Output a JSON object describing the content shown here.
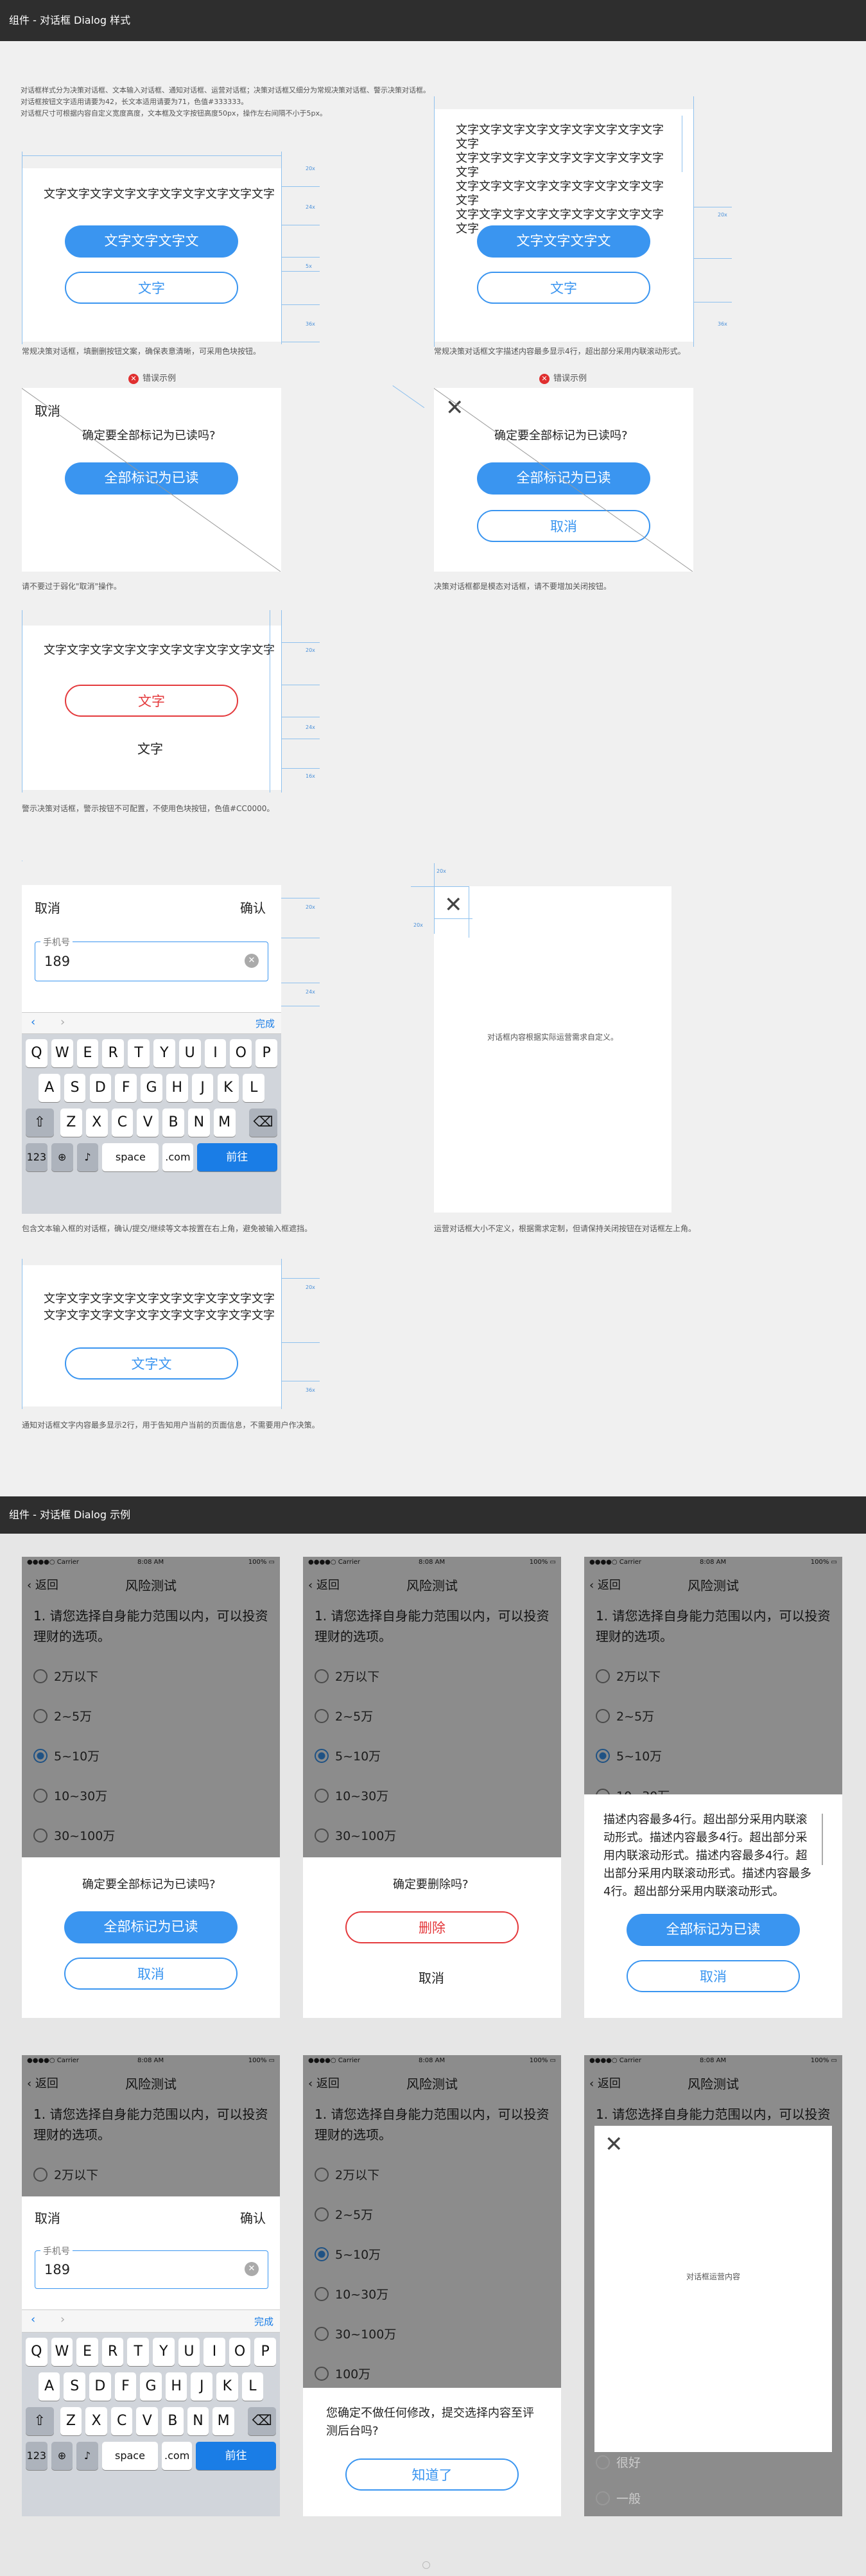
{
  "section1": {
    "title": "组件 - 对话框 Dialog 样式"
  },
  "section2": {
    "title": "组件 - 对话框 Dialog 示例"
  },
  "intro": [
    "对话框样式分为决策对话框、文本输入对话框、通知对话框、运营对话框；决策对话框又细分为常规决策对话框、警示决策对话框。",
    "对话框按钮文字适用请要为42，长文本适用请要为71，色值#333333。",
    "对话框尺寸可根据内容自定义宽度高度，文本框及文字按钮高度50px，操作左右间隔不小于5px。"
  ],
  "sample_text": "文字文字文字文字文字文字文字文字文字文字",
  "btn_text_long": "文字文字文字文",
  "btn_text": "文字",
  "btn_text_2": "文字文",
  "confirm_q": "确定要全部标记为已读吗?",
  "mark_all": "全部标记为已读",
  "cancel": "取消",
  "confirm": "确认",
  "error_label": "错误示例",
  "notes": {
    "n1": "常规决策对话框，填删删按钮文案，确保表意清晰，可采用色块按钮。",
    "n2": "常规决策对话框文字描述内容最多显示4行，超出部分采用内联滚动形式。",
    "n3": "请不要过于弱化\"取消\"操作。",
    "n4": "决策对话框都是模态对话框，请不要增加关闭按钮。",
    "n5": "警示决策对话框，警示按钮不可配置，不使用色块按钮，色值#CC0000。",
    "n6": "包含文本输入框的对话框，确认/提交/继续等文本按置在右上角，避免被输入框遮挡。",
    "n7": "运营对话框大小不定义，根据需求定制，但请保持关闭按钮在对话框左上角。",
    "n8": "通知对话框文字内容最多显示2行，用于告知用户当前的页面信息，不需要用户作决策。"
  },
  "input": {
    "label": "手机号",
    "value": "189"
  },
  "done": "完成",
  "kb": {
    "row1": [
      "Q",
      "W",
      "E",
      "R",
      "T",
      "Y",
      "U",
      "I",
      "O",
      "P"
    ],
    "row2": [
      "A",
      "S",
      "D",
      "F",
      "G",
      "H",
      "J",
      "K",
      "L"
    ],
    "row3": [
      "Z",
      "X",
      "C",
      "V",
      "B",
      "N",
      "M"
    ],
    "n123": "123",
    "space": "space",
    "com": ".com",
    "go": "前往"
  },
  "ops_custom": "对话框内容根据实际运营需求自定义。",
  "phone": {
    "carrier": "Carrier",
    "time": "8:08 AM",
    "battery": "100%",
    "back": "返回",
    "title": "风险测试",
    "question": "1. 请您选择自身能力范围以内，可以投资理财的选项。",
    "options": [
      "2万以下",
      "2~5万",
      "5~10万",
      "10~30万",
      "30~100万",
      "100万"
    ],
    "delete_q": "确定要删除吗?",
    "delete": "删除",
    "long_text": "描述内容最多4行。超出部分采用内联滚动形式。描述内容最多4行。超出部分采用内联滚动形式。描述内容最多4行。超出部分采用内联滚动形式。描述内容最多4行。超出部分采用内联滚动形式。",
    "notify_text": "您确定不做任何修改，提交选择内容至评测后台吗?",
    "got_it": "知道了",
    "ops_content": "对话框运营内容",
    "good": "很好",
    "normal": "一般"
  },
  "measures": [
    "2x",
    "3x",
    "4x",
    "5x",
    "10x",
    "16x",
    "20x",
    "24x",
    "36x"
  ]
}
